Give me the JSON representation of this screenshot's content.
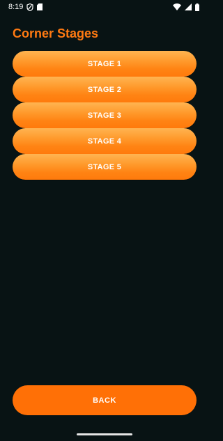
{
  "status_bar": {
    "time": "8:19",
    "icons": [
      "privacy-shield-icon",
      "sim-card-icon",
      "wifi-icon",
      "signal-icon",
      "battery-icon"
    ]
  },
  "header": {
    "title": "Corner Stages"
  },
  "stages": [
    {
      "label": "STAGE 1"
    },
    {
      "label": "STAGE 2"
    },
    {
      "label": "STAGE 3"
    },
    {
      "label": "STAGE 4"
    },
    {
      "label": "STAGE 5"
    }
  ],
  "footer": {
    "back_label": "BACK"
  },
  "colors": {
    "background": "#081314",
    "accent": "#ff7a12",
    "button_top": "#ffb451",
    "button_bottom": "#ff7a0c",
    "back_button": "#ff7006",
    "text_on_button": "#ffffff"
  }
}
